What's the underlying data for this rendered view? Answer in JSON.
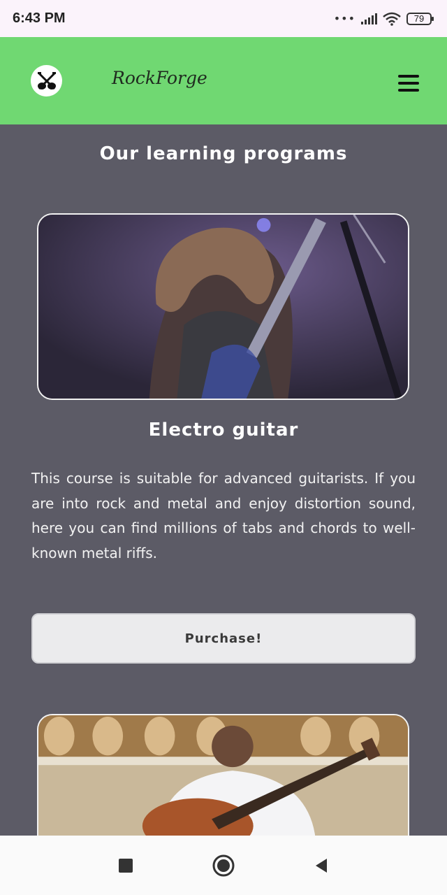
{
  "status_bar": {
    "time": "6:43 PM",
    "battery": "79"
  },
  "header": {
    "brand": "RockForge",
    "logo_icon": "guitar-cross-icon",
    "menu_icon": "hamburger-menu-icon",
    "background": "#70d872"
  },
  "main": {
    "section_title": "Our learning programs",
    "courses": [
      {
        "title": "Electro guitar",
        "description": "This course is suitable for advanced guitarists. If you are into rock and metal and enjoy distortion sound, here you can find millions of tabs and chords to well-known metal riffs.",
        "button_label": "Purchase!"
      }
    ]
  },
  "nav_bar": {
    "items": [
      "recents-square-icon",
      "home-circle-icon",
      "back-triangle-icon"
    ]
  },
  "colors": {
    "page_background": "#5c5b66",
    "button_background": "#ebebed",
    "text": "#ffffff"
  }
}
